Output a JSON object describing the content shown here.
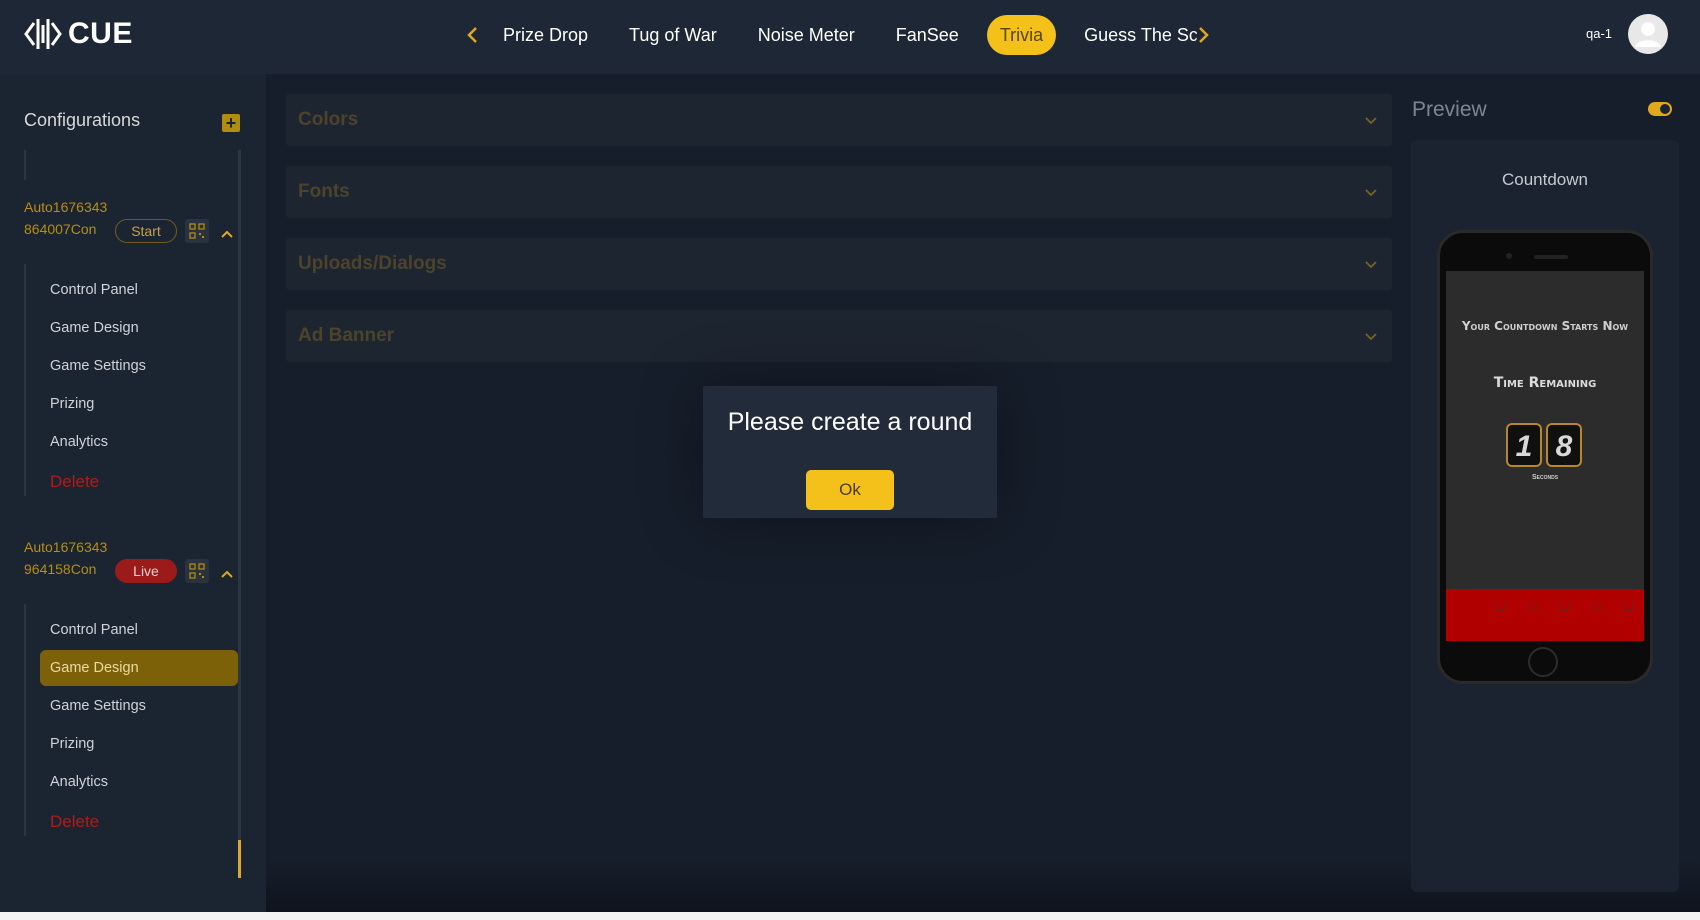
{
  "header": {
    "logo_text": "CUE",
    "tabs": [
      {
        "label": "Prize Drop",
        "active": false
      },
      {
        "label": "Tug of War",
        "active": false
      },
      {
        "label": "Noise Meter",
        "active": false
      },
      {
        "label": "FanSee",
        "active": false
      },
      {
        "label": "Trivia",
        "active": true
      },
      {
        "label": "Guess The Sco",
        "active": false
      }
    ],
    "user_name": "qa-1"
  },
  "sidebar": {
    "title": "Configurations",
    "configs": [
      {
        "name": "Auto1676343864007Con",
        "status": "Start",
        "menu": [
          "Control Panel",
          "Game Design",
          "Game Settings",
          "Prizing",
          "Analytics"
        ],
        "delete_label": "Delete"
      },
      {
        "name": "Auto1676343964158Con",
        "status": "Live",
        "menu": [
          "Control Panel",
          "Game Design",
          "Game Settings",
          "Prizing",
          "Analytics"
        ],
        "delete_label": "Delete",
        "active_item": "Game Design"
      }
    ]
  },
  "main": {
    "sections": [
      "Colors",
      "Fonts",
      "Uploads/Dialogs",
      "Ad Banner"
    ]
  },
  "dialog": {
    "message": "Please create a round",
    "ok_label": "Ok"
  },
  "preview": {
    "title": "Preview",
    "subtitle": "Countdown",
    "screen_heading": "Your Countdown Starts Now",
    "time_label": "Time Remaining",
    "digits": [
      "1",
      "8"
    ],
    "seconds_label": "Seconds"
  },
  "colors": {
    "accent": "#f4c01a",
    "live": "#9b1b1b",
    "delete": "#b01b1b"
  }
}
